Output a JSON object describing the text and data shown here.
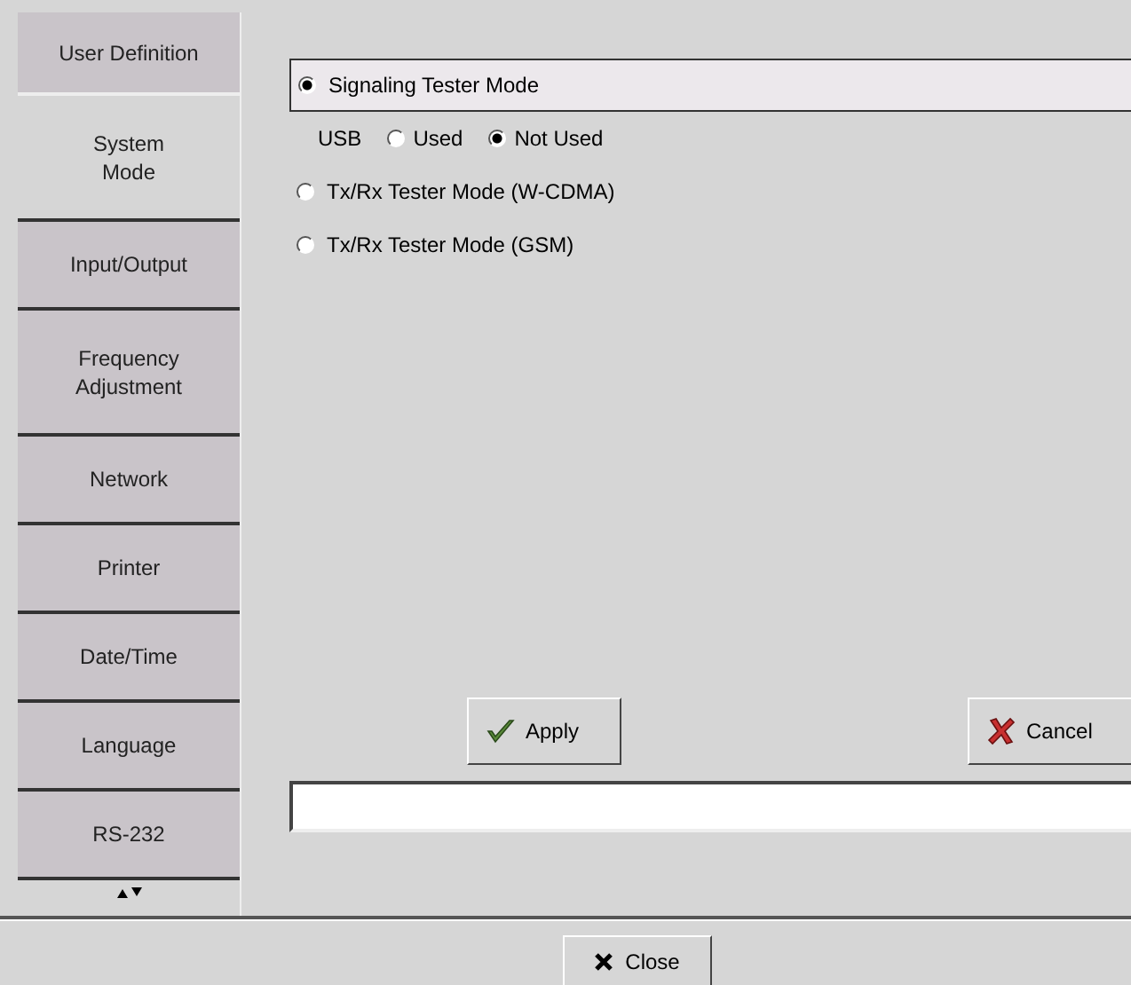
{
  "tabs": [
    {
      "label": "User Definition",
      "selected": false
    },
    {
      "label": "System\nMode",
      "selected": true
    },
    {
      "label": "Input/Output",
      "selected": false
    },
    {
      "label": "Frequency\nAdjustment",
      "selected": false
    },
    {
      "label": "Network",
      "selected": false
    },
    {
      "label": "Printer",
      "selected": false
    },
    {
      "label": "Date/Time",
      "selected": false
    },
    {
      "label": "Language",
      "selected": false
    },
    {
      "label": "RS-232",
      "selected": false
    }
  ],
  "modes": [
    {
      "label": "Signaling Tester Mode",
      "selected": true,
      "usb": {
        "label": "USB",
        "options": [
          {
            "label": "Used",
            "selected": false
          },
          {
            "label": "Not Used",
            "selected": true
          }
        ]
      }
    },
    {
      "label": "Tx/Rx Tester Mode (W-CDMA)",
      "selected": false
    },
    {
      "label": "Tx/Rx Tester Mode (GSM)",
      "selected": false
    }
  ],
  "apply_button": "Apply",
  "cancel_button": "Cancel",
  "close_button": "Close"
}
